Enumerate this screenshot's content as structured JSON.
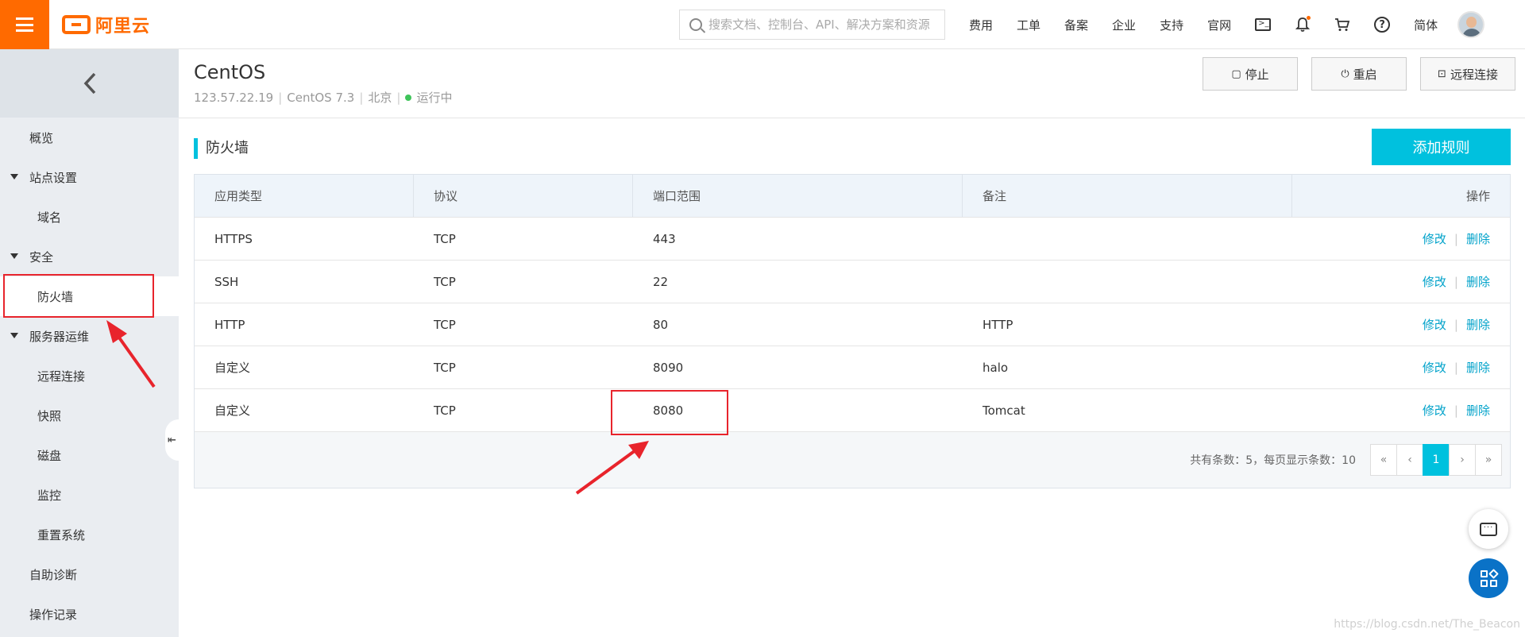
{
  "topbar": {
    "logo_text": "阿里云",
    "search_placeholder": "搜索文档、控制台、API、解决方案和资源",
    "nav": [
      "费用",
      "工单",
      "备案",
      "企业",
      "支持",
      "官网"
    ],
    "lang": "简体",
    "icons": [
      "terminal-icon",
      "bell-icon",
      "cart-icon",
      "help-icon"
    ]
  },
  "sidebar": {
    "items": [
      {
        "label": "概览"
      },
      {
        "label": "站点设置"
      },
      {
        "label": "域名"
      },
      {
        "label": "安全"
      },
      {
        "label": "防火墙"
      },
      {
        "label": "服务器运维"
      },
      {
        "label": "远程连接"
      },
      {
        "label": "快照"
      },
      {
        "label": "磁盘"
      },
      {
        "label": "监控"
      },
      {
        "label": "重置系统"
      },
      {
        "label": "自助诊断"
      },
      {
        "label": "操作记录"
      }
    ]
  },
  "header": {
    "title": "CentOS",
    "ip": "123.57.22.19",
    "os": "CentOS 7.3",
    "region": "北京",
    "status": "运行中",
    "buttons": {
      "stop": "停止",
      "restart": "重启",
      "remote": "远程连接"
    }
  },
  "firewall": {
    "section_title": "防火墙",
    "add_label": "添加规则",
    "columns": [
      "应用类型",
      "协议",
      "端口范围",
      "备注",
      "操作"
    ],
    "rows": [
      {
        "type": "HTTPS",
        "protocol": "TCP",
        "port": "443",
        "note": ""
      },
      {
        "type": "SSH",
        "protocol": "TCP",
        "port": "22",
        "note": ""
      },
      {
        "type": "HTTP",
        "protocol": "TCP",
        "port": "80",
        "note": "HTTP"
      },
      {
        "type": "自定义",
        "protocol": "TCP",
        "port": "8090",
        "note": "halo"
      },
      {
        "type": "自定义",
        "protocol": "TCP",
        "port": "8080",
        "note": "Tomcat"
      }
    ],
    "actions": {
      "edit": "修改",
      "delete": "删除",
      "sep": "|"
    },
    "pager_info": "共有条数：5，每页显示条数：10",
    "pager": {
      "first": "«",
      "prev": "‹",
      "current": "1",
      "next": "›",
      "last": "»"
    }
  },
  "colors": {
    "brand": "#ff6a00",
    "accent": "#00c1de",
    "link": "#00a2ca",
    "annotation": "#e8242c"
  },
  "watermark": "https://blog.csdn.net/The_Beacon"
}
